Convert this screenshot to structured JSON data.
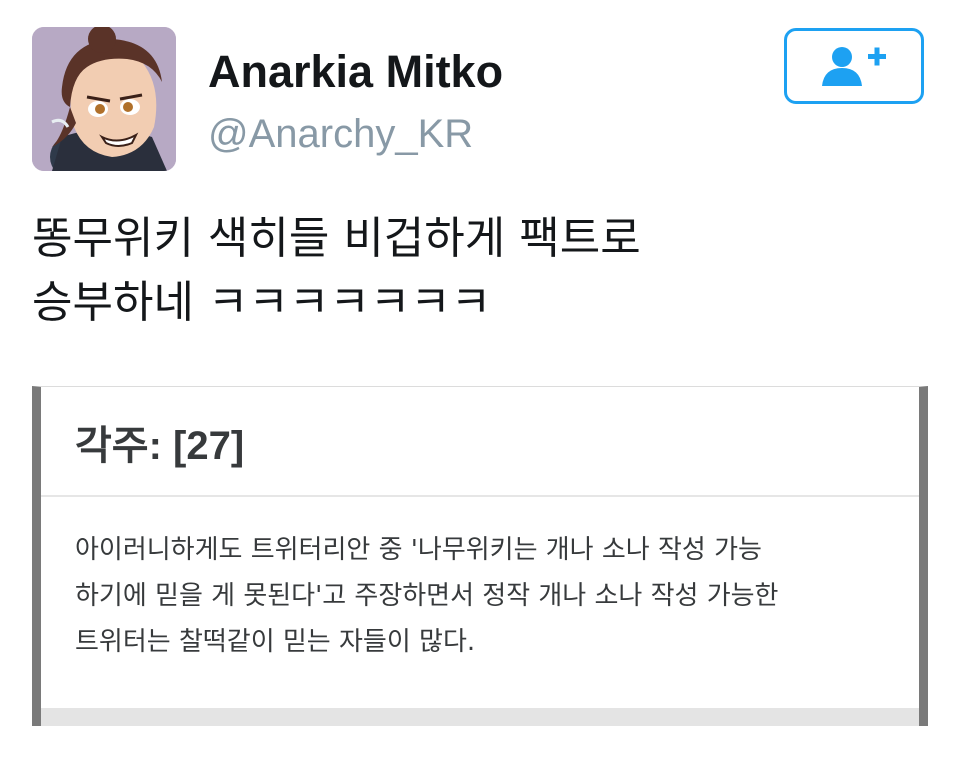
{
  "tweet": {
    "author": {
      "display_name": "Anarkia Mitko",
      "handle": "@Anarchy_KR",
      "avatar_icon": "profile-avatar"
    },
    "follow_button": {
      "icon": "add-user-icon",
      "accent_color": "#1da1f2"
    },
    "text_lines": [
      "똥무위키 색히들 비겁하게 팩트로",
      "승부하네 ㅋㅋㅋㅋㅋㅋㅋ"
    ],
    "media": {
      "title": "각주: [27]",
      "body_lines": [
        "아이러니하게도 트위터리안 중 '나무위키는 개나 소나 작성 가능",
        "하기에 믿을 게 못된다'고 주장하면서 정작 개나 소나 작성 가능한",
        "트위터는 찰떡같이 믿는 자들이 많다."
      ]
    }
  }
}
